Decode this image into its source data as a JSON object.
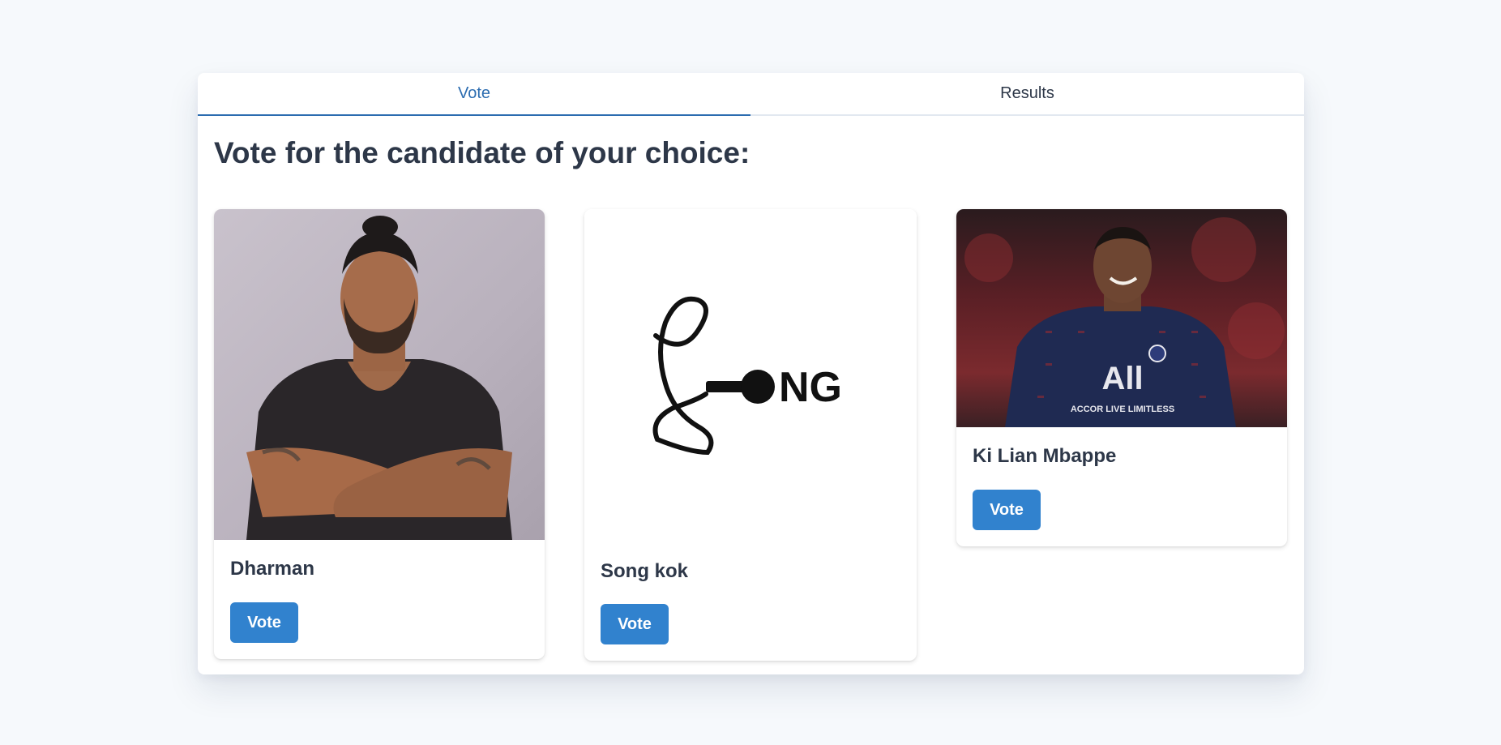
{
  "tabs": [
    {
      "label": "Vote",
      "active": true
    },
    {
      "label": "Results",
      "active": false
    }
  ],
  "heading": "Vote for the candidate of your choice:",
  "candidates": [
    {
      "name": "Dharman",
      "vote_label": "Vote",
      "photo": "portrait-man-arms-crossed"
    },
    {
      "name": "Song kok",
      "vote_label": "Vote",
      "photo": "song-logo",
      "logo_text": "NG"
    },
    {
      "name": "Ki Lian Mbappe",
      "vote_label": "Vote",
      "photo": "footballer-smiling",
      "shirt_text": "ACCOR LIVE LIMITLESS"
    }
  ],
  "colors": {
    "accent": "#2b6cb0",
    "button": "#3182ce",
    "text": "#2d3748",
    "background": "#f6f9fc"
  }
}
